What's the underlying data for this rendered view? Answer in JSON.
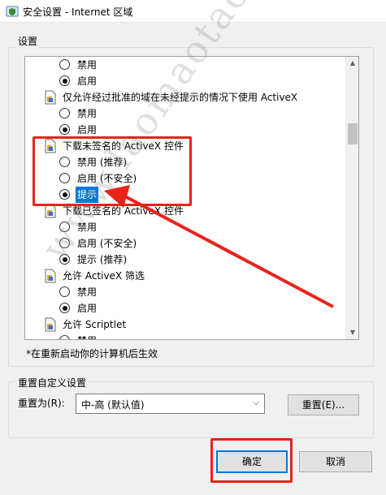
{
  "window": {
    "title": "安全设置 - Internet 区域",
    "icon": "shield-settings-icon"
  },
  "settings_group": {
    "label": "设置",
    "items": [
      {
        "kind": "option",
        "label": "禁用",
        "checked": false
      },
      {
        "kind": "option",
        "label": "启用",
        "checked": true
      },
      {
        "kind": "parent",
        "label": "仅允许经过批准的域在未经提示的情况下使用 ActiveX",
        "icon": "document-settings-icon"
      },
      {
        "kind": "option",
        "label": "禁用",
        "checked": false
      },
      {
        "kind": "option",
        "label": "启用",
        "checked": true
      },
      {
        "kind": "parent",
        "label": "下载未签名的 ActiveX 控件",
        "icon": "document-settings-icon"
      },
      {
        "kind": "option",
        "label": "禁用 (推荐)",
        "checked": false
      },
      {
        "kind": "option",
        "label": "启用 (不安全)",
        "checked": false
      },
      {
        "kind": "option",
        "label": "提示",
        "checked": true,
        "selected": true
      },
      {
        "kind": "parent",
        "label": "下载已签名的 ActiveX 控件",
        "icon": "document-settings-icon"
      },
      {
        "kind": "option",
        "label": "禁用",
        "checked": false
      },
      {
        "kind": "option",
        "label": "启用 (不安全)",
        "checked": false
      },
      {
        "kind": "option",
        "label": "提示 (推荐)",
        "checked": true
      },
      {
        "kind": "parent",
        "label": "允许 ActiveX 筛选",
        "icon": "document-settings-icon"
      },
      {
        "kind": "option",
        "label": "禁用",
        "checked": false
      },
      {
        "kind": "option",
        "label": "启用",
        "checked": true
      },
      {
        "kind": "parent",
        "label": "允许 Scriptlet",
        "icon": "document-settings-icon"
      },
      {
        "kind": "option",
        "label": "禁用",
        "checked": false
      }
    ]
  },
  "note": "*在重新启动你的计算机后生效",
  "reset_group": {
    "label": "重置自定义设置",
    "reset_to_label": "重置为(R):",
    "select_value": "中-高 (默认值)",
    "reset_button": "重置(E)..."
  },
  "buttons": {
    "ok": "确定",
    "cancel": "取消"
  },
  "watermark": "www.laomaotao.net",
  "colors": {
    "selection": "#0078d7",
    "annotation": "#e8231b",
    "focus_border": "#0078d7"
  }
}
